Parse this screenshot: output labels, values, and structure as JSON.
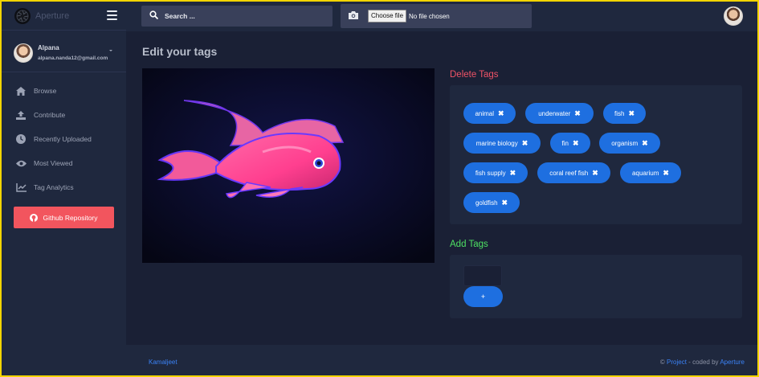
{
  "app": {
    "name": "Aperture"
  },
  "user": {
    "name": "Alpana",
    "email": "alpana.nanda12@gmail.com"
  },
  "sidebar": {
    "items": [
      {
        "label": "Browse",
        "icon": "home-icon"
      },
      {
        "label": "Contribute",
        "icon": "upload-icon"
      },
      {
        "label": "Recently Uploaded",
        "icon": "clock-icon"
      },
      {
        "label": "Most Viewed",
        "icon": "eye-icon"
      },
      {
        "label": "Tag Analytics",
        "icon": "chart-line-icon"
      }
    ],
    "github_label": "Github Repository"
  },
  "topbar": {
    "search_placeholder": "Search ...",
    "file_button": "Choose file",
    "file_status": "No file chosen"
  },
  "main": {
    "title": "Edit your tags",
    "delete_title": "Delete Tags",
    "add_title": "Add Tags",
    "add_button": "+",
    "tags": [
      "animal",
      "underwater",
      "fish",
      "marine biology",
      "fin",
      "organism",
      "fish supply",
      "coral reef fish",
      "aquarium",
      "goldfish"
    ]
  },
  "footer": {
    "left": "Kamaljeet",
    "copyright": "©",
    "project": "Project",
    "coded_by": " - coded by ",
    "brand": "Aperture"
  },
  "colors": {
    "accent": "#1e6fe0",
    "danger": "#f05367",
    "success": "#4ee063",
    "github": "#f2555e",
    "background": "#1a2035",
    "panel": "#1f283e"
  }
}
